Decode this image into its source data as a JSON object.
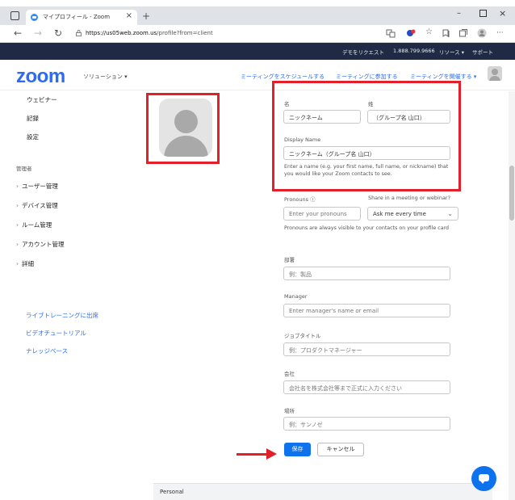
{
  "browser": {
    "tab_title": "マイプロフィール - Zoom",
    "tab_close": "×",
    "new_tab": "+",
    "url_domain": "https://us05web.zoom.us",
    "url_path": "/profile?from=client",
    "win_min": "–",
    "win_close": "×",
    "more": "···"
  },
  "promo_bar": {
    "demo": "デモをリクエスト",
    "phone": "1.888.799.9666",
    "resources": "リソース ▾",
    "support": "サポート"
  },
  "header": {
    "logo": "zoom",
    "solutions": "ソリューション ▾",
    "schedule": "ミーティングをスケジュールする",
    "join": "ミーティングに参加する",
    "host": "ミーティングを開催する ▾"
  },
  "sidebar": {
    "items": [
      "ウェビナー",
      "記録",
      "設定"
    ],
    "admin_label": "管理者",
    "admin_items": [
      "ユーザー管理",
      "デバイス管理",
      "ルーム管理",
      "アカウント管理",
      "詳細"
    ],
    "links": [
      "ライブトレーニングに出席",
      "ビデオチュートリアル",
      "ナレッジベース"
    ]
  },
  "form": {
    "first_name_label": "名",
    "last_name_label": "姓",
    "first_name_value": "ニックネーム",
    "last_name_value": "（グループ名 山口）",
    "display_name_label": "Display Name",
    "display_name_value": "ニックネーム（グループ名 山口）",
    "display_name_help": "Enter a name (e.g. your first name, full name, or nickname) that you would like your Zoom contacts to see.",
    "pronouns_label": "Pronouns ⓘ",
    "pronouns_placeholder": "Enter your pronouns",
    "share_label": "Share in a meeting or webinar?",
    "share_value": "Ask me every time",
    "pronouns_help": "Pronouns are always visible to your contacts on your profile card",
    "department_label": "部署",
    "department_placeholder": "例：製品",
    "manager_label": "Manager",
    "manager_placeholder": "Enter manager's name or email",
    "job_label": "ジョブタイトル",
    "job_placeholder": "例：プロダクトマネージャー",
    "company_label": "会社",
    "company_placeholder": "会社名を株式会社等まで正式に入力ください",
    "location_label": "場所",
    "location_placeholder": "例：サンノゼ",
    "save": "保存",
    "cancel": "キャンセル"
  },
  "personal_section": "Personal",
  "colors": {
    "accent": "#0e72ed",
    "highlight": "#e3202a",
    "dark_bar": "#1f2a44"
  }
}
